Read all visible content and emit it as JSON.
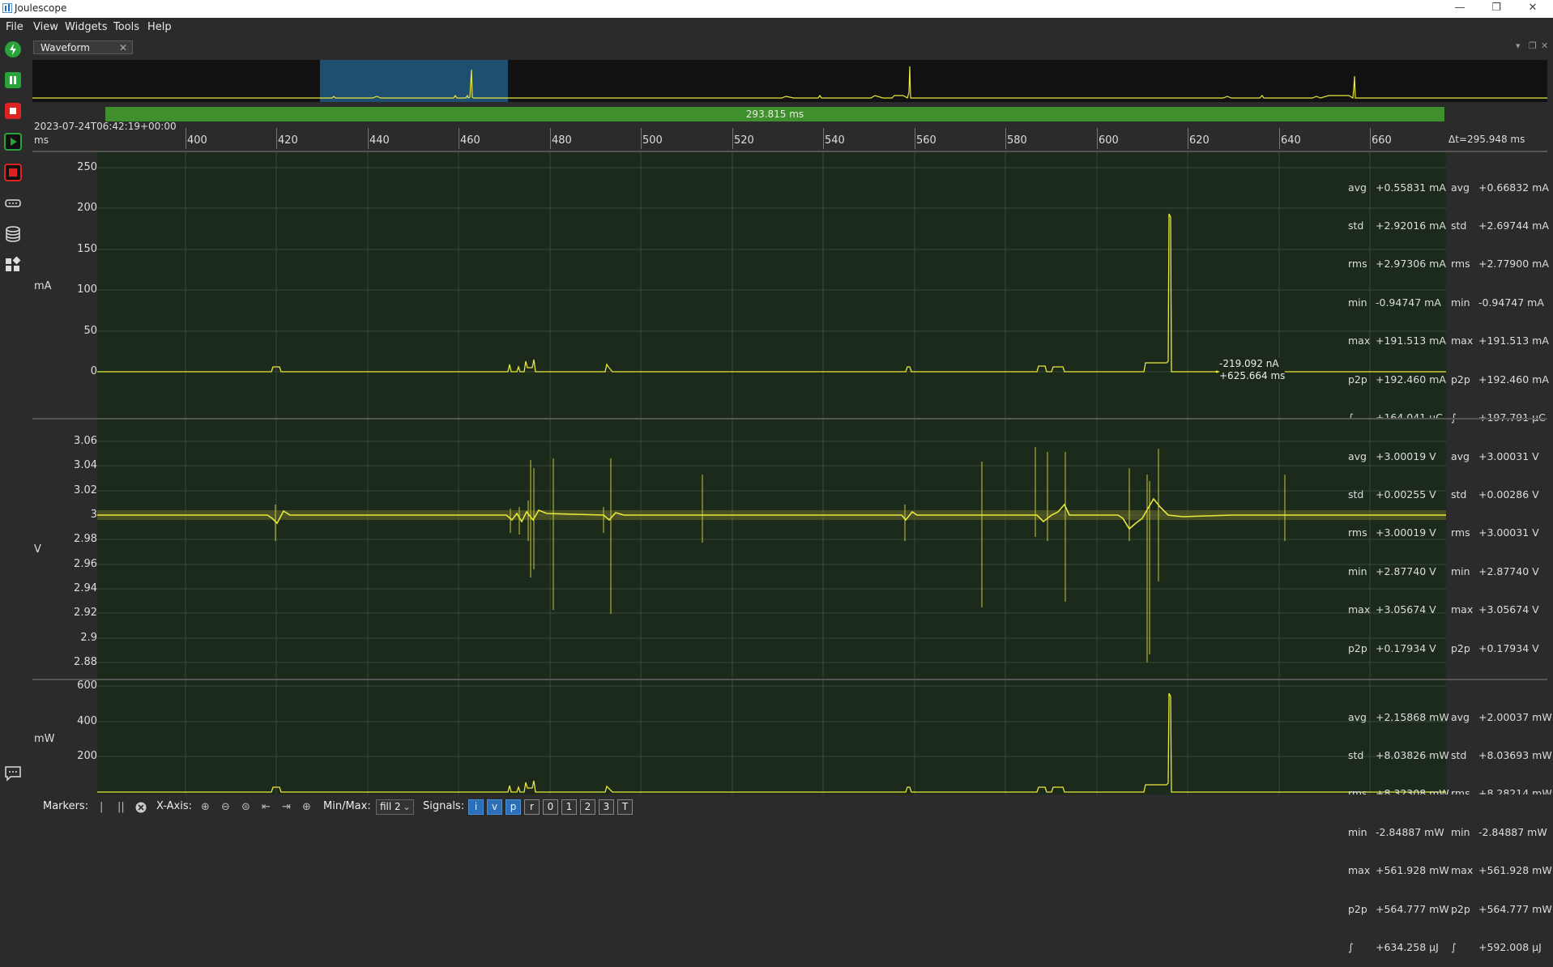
{
  "window": {
    "title": "Joulescope"
  },
  "menu": [
    "File",
    "View",
    "Widgets",
    "Tools",
    "Help"
  ],
  "tab": {
    "label": "Waveform"
  },
  "waveform": {
    "duration": "293.815 ms",
    "datetime": "2023-07-24T06:42:19+00:00",
    "x_unit": "ms",
    "delta_t": "Δt=295.948 ms",
    "x_ticks": [
      "400",
      "420",
      "440",
      "460",
      "480",
      "500",
      "520",
      "540",
      "560",
      "580",
      "600",
      "620",
      "640",
      "660"
    ],
    "marker": {
      "value": "-219.092 nA",
      "time": "+625.664 ms"
    }
  },
  "current": {
    "unit": "mA",
    "y_ticks": [
      "250",
      "200",
      "150",
      "100",
      "50",
      "0"
    ],
    "stats_left": [
      [
        "avg",
        "+0.55831",
        "mA"
      ],
      [
        "std",
        "+2.92016",
        "mA"
      ],
      [
        "rms",
        "+2.97306",
        "mA"
      ],
      [
        "min",
        "-0.94747",
        "mA"
      ],
      [
        "max",
        "+191.513",
        "mA"
      ],
      [
        "p2p",
        "+192.460",
        "mA"
      ],
      [
        "∫",
        "+164.041",
        "µC"
      ]
    ],
    "stats_right": [
      [
        "avg",
        "+0.66832",
        "mA"
      ],
      [
        "std",
        "+2.69744",
        "mA"
      ],
      [
        "rms",
        "+2.77900",
        "mA"
      ],
      [
        "min",
        "-0.94747",
        "mA"
      ],
      [
        "max",
        "+191.513",
        "mA"
      ],
      [
        "p2p",
        "+192.460",
        "mA"
      ],
      [
        "∫",
        "+197.791",
        "µC"
      ]
    ]
  },
  "voltage": {
    "unit": "V",
    "y_ticks": [
      "3.06",
      "3.04",
      "3.02",
      "3",
      "2.98",
      "2.96",
      "2.94",
      "2.92",
      "2.9",
      "2.88"
    ],
    "stats_left": [
      [
        "avg",
        "+3.00019",
        "V"
      ],
      [
        "std",
        "+0.00255",
        "V"
      ],
      [
        "rms",
        "+3.00019",
        "V"
      ],
      [
        "min",
        "+2.87740",
        "V"
      ],
      [
        "max",
        "+3.05674",
        "V"
      ],
      [
        "p2p",
        "+0.17934",
        "V"
      ]
    ],
    "stats_right": [
      [
        "avg",
        "+3.00031",
        "V"
      ],
      [
        "std",
        "+0.00286",
        "V"
      ],
      [
        "rms",
        "+3.00031",
        "V"
      ],
      [
        "min",
        "+2.87740",
        "V"
      ],
      [
        "max",
        "+3.05674",
        "V"
      ],
      [
        "p2p",
        "+0.17934",
        "V"
      ]
    ]
  },
  "power": {
    "unit": "mW",
    "y_ticks": [
      "600",
      "400",
      "200"
    ],
    "stats_left": [
      [
        "avg",
        "+2.15868",
        "mW"
      ],
      [
        "std",
        "+8.03826",
        "mW"
      ],
      [
        "rms",
        "+8.32308",
        "mW"
      ],
      [
        "min",
        "-2.84887",
        "mW"
      ],
      [
        "max",
        "+561.928",
        "mW"
      ],
      [
        "p2p",
        "+564.777",
        "mW"
      ],
      [
        "∫",
        "+634.258",
        "µJ"
      ]
    ],
    "stats_right": [
      [
        "avg",
        "+2.00037",
        "mW"
      ],
      [
        "std",
        "+8.03693",
        "mW"
      ],
      [
        "rms",
        "+8.28214",
        "mW"
      ],
      [
        "min",
        "-2.84887",
        "mW"
      ],
      [
        "max",
        "+561.928",
        "mW"
      ],
      [
        "p2p",
        "+564.777",
        "mW"
      ],
      [
        "∫",
        "+592.008",
        "µJ"
      ]
    ]
  },
  "bottombar": {
    "markers_label": "Markers:",
    "xaxis_label": "X-Axis:",
    "minmax_label": "Min/Max:",
    "minmax_value": "fill 2",
    "signals_label": "Signals:",
    "signals": [
      {
        "label": "i",
        "active": true
      },
      {
        "label": "v",
        "active": true
      },
      {
        "label": "p",
        "active": true
      },
      {
        "label": "r",
        "active": false
      },
      {
        "label": "0",
        "active": false
      },
      {
        "label": "1",
        "active": false
      },
      {
        "label": "2",
        "active": false
      },
      {
        "label": "3",
        "active": false
      },
      {
        "label": "T",
        "active": false
      }
    ]
  },
  "colors": {
    "trace": "#e8e83a",
    "plot_bg": "#1b2a1b",
    "selection": "#1e4f70",
    "duration_bar": "#3f8f2f",
    "signal_on": "#2a6fb8"
  },
  "icons": [
    "joulescope-app-icon",
    "power-icon",
    "pause-icon",
    "stop-icon",
    "play-icon",
    "record-icon",
    "device-icon",
    "storage-icon",
    "widgets-icon",
    "chat-icon",
    "menu-icon"
  ]
}
